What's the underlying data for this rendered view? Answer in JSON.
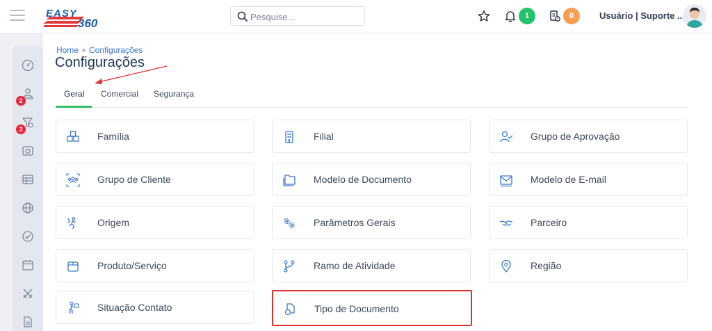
{
  "header": {
    "logo_word": "EASY",
    "logo_number": "360",
    "search_placeholder": "Pesquise...",
    "notifications_count": "1",
    "tasks_count": "0",
    "user_label": "Usuário | Suporte ..."
  },
  "sidebar": {
    "badges": [
      "2",
      "3"
    ],
    "icons": [
      "dashboard-icon",
      "users-icon",
      "funnel-icon",
      "camera-icon",
      "table-icon",
      "globe-icon",
      "check-circle-icon",
      "calendar-icon",
      "swords-icon",
      "document-icon"
    ]
  },
  "breadcrumb": {
    "home": "Home",
    "current": "Configurações"
  },
  "page_title": "Configurações",
  "tabs": [
    {
      "label": "Geral",
      "active": true
    },
    {
      "label": "Comercial",
      "active": false
    },
    {
      "label": "Segurança",
      "active": false
    }
  ],
  "cards": [
    {
      "label": "Família",
      "icon": "boxes-icon"
    },
    {
      "label": "Filial",
      "icon": "building-icon"
    },
    {
      "label": "Grupo de Aprovação",
      "icon": "user-check-icon"
    },
    {
      "label": "Grupo de Cliente",
      "icon": "group-icon"
    },
    {
      "label": "Modelo de Documento",
      "icon": "folder-icon"
    },
    {
      "label": "Modelo de E-mail",
      "icon": "mail-icon"
    },
    {
      "label": "Origem",
      "icon": "origin-icon"
    },
    {
      "label": "Parâmetros Gerais",
      "icon": "gears-icon"
    },
    {
      "label": "Parceiro",
      "icon": "handshake-icon"
    },
    {
      "label": "Produto/Serviço",
      "icon": "box-icon"
    },
    {
      "label": "Ramo de Atividade",
      "icon": "branch-icon"
    },
    {
      "label": "Região",
      "icon": "map-pin-icon"
    },
    {
      "label": "Situação Contato",
      "icon": "person-status-icon"
    },
    {
      "label": "Tipo de Documento",
      "icon": "document-type-icon",
      "highlighted": true
    }
  ],
  "colors": {
    "accent": "#3a78c9",
    "tab_active_underline": "#2fc06a",
    "badge_green": "#23c26b",
    "badge_orange": "#f5a050",
    "highlight_border": "#e03030",
    "annotation_arrow": "#e03030"
  }
}
